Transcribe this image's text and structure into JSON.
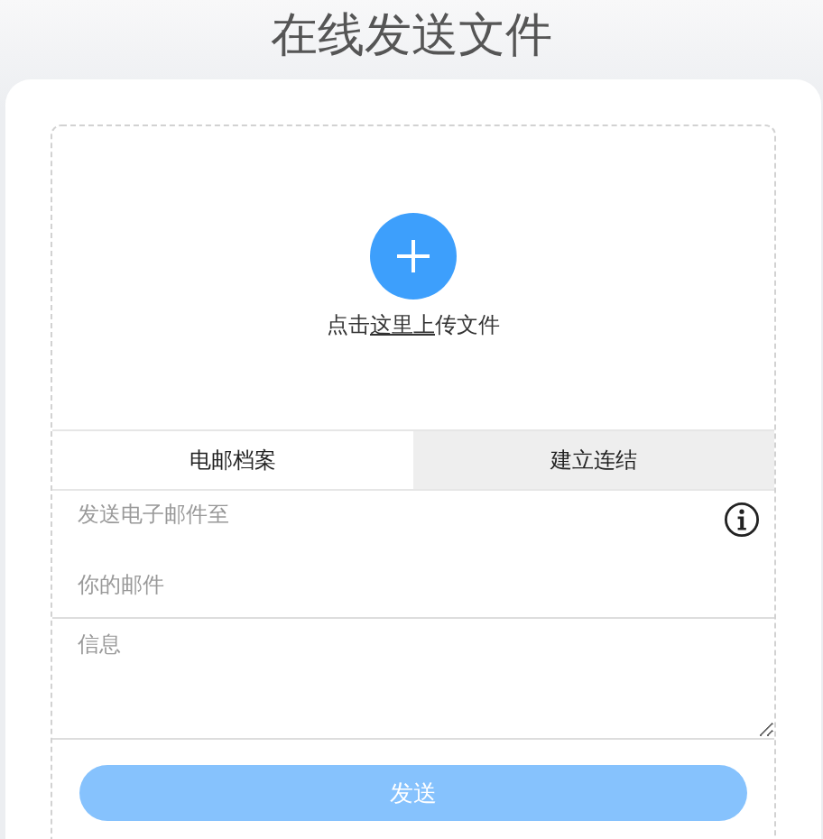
{
  "title": "在线发送文件",
  "upload": {
    "parts": [
      {
        "kind": "text",
        "text": "点击"
      },
      {
        "kind": "link",
        "text": "这里上"
      },
      {
        "kind": "text",
        "text": "传文件"
      }
    ]
  },
  "tabs": [
    {
      "label": "电邮档案",
      "selected": true
    },
    {
      "label": "建立连结",
      "selected": false
    }
  ],
  "fields": [
    {
      "placeholder": "发送电子邮件至",
      "info": true
    },
    {
      "placeholder": "你的邮件",
      "info": false
    }
  ],
  "message": {
    "placeholder": "信息"
  },
  "send_button": {
    "label": "发送",
    "disabled": true
  }
}
